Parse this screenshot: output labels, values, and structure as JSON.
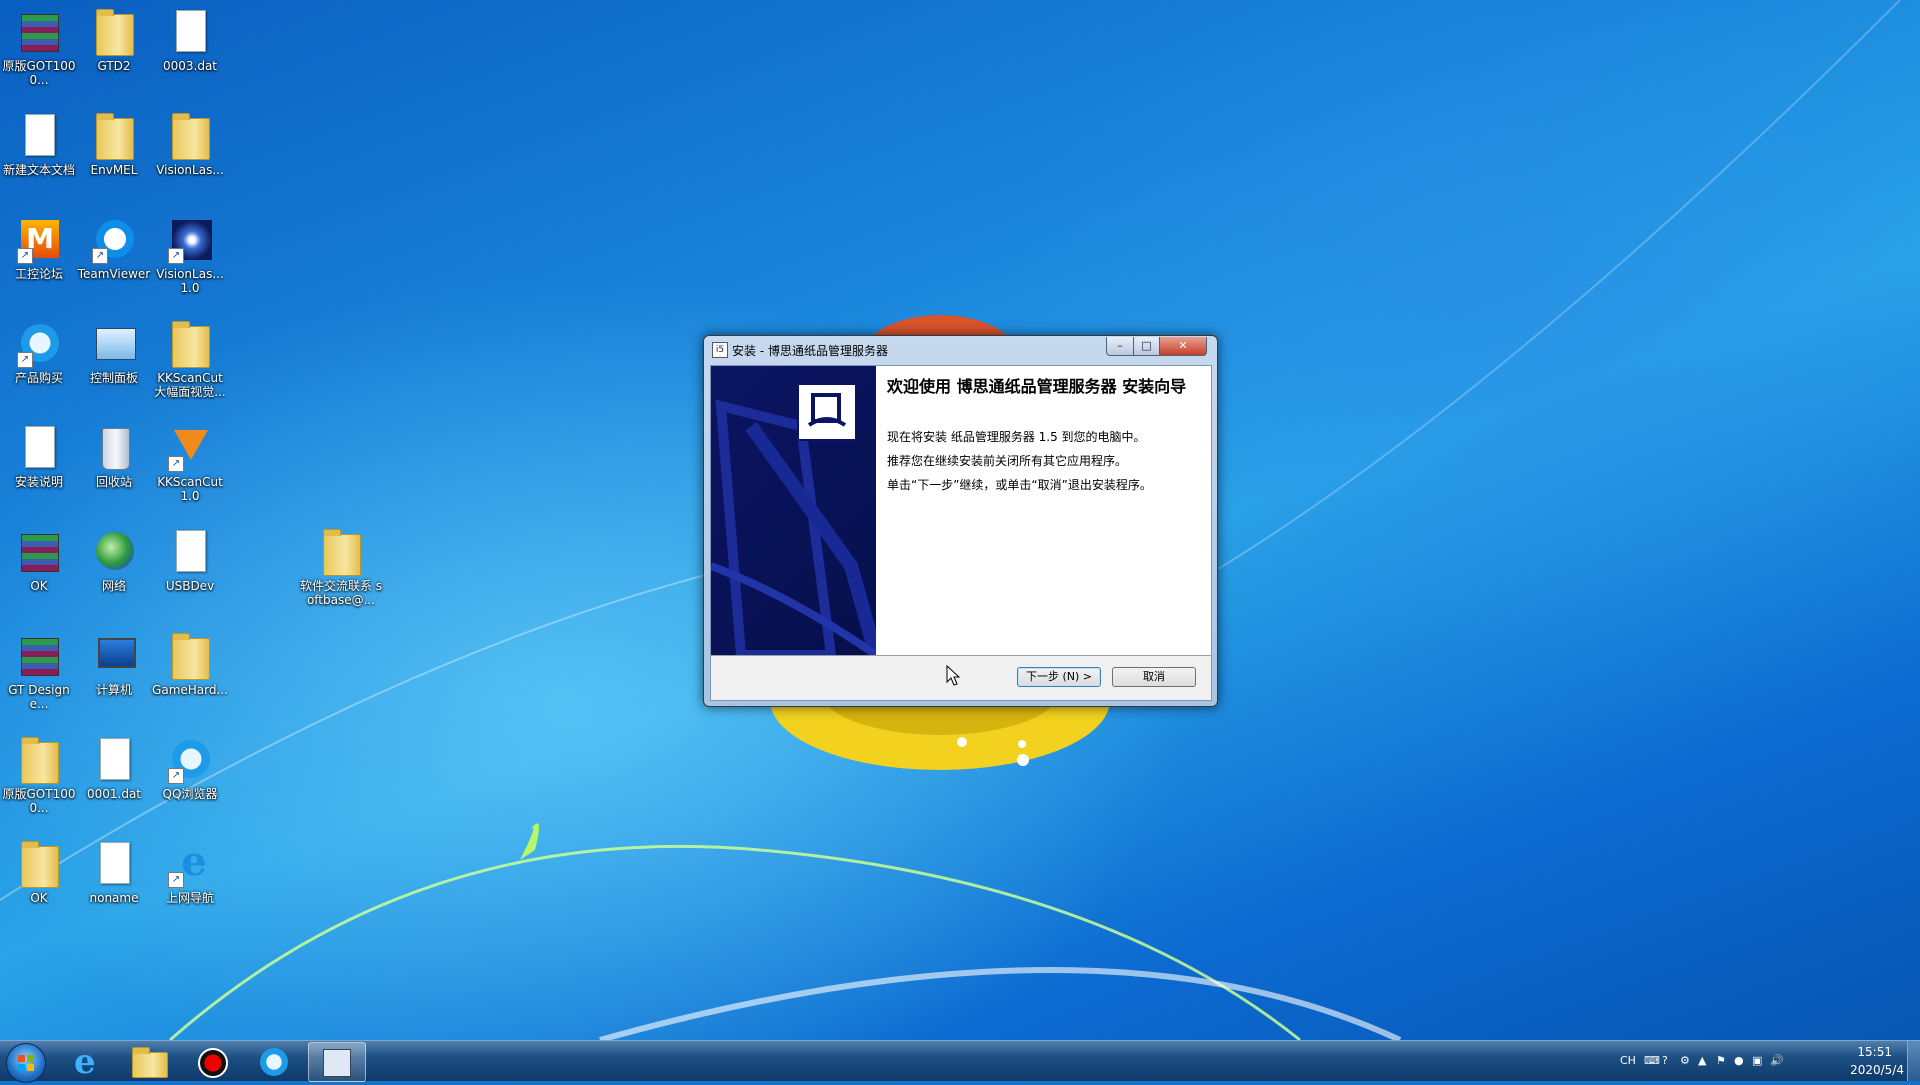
{
  "desktop": {
    "icons": [
      {
        "label": "原版GOT1000...",
        "icon": "winrar-archive-icon"
      },
      {
        "label": "GTD2",
        "icon": "folder-icon"
      },
      {
        "label": "0003.dat",
        "icon": "file-icon"
      },
      {
        "label": "新建文本文档",
        "icon": "text-file-icon"
      },
      {
        "label": "EnvMEL",
        "icon": "folder-icon"
      },
      {
        "label": "VisionLas...",
        "icon": "folder-icon"
      },
      {
        "label": "工控论坛",
        "icon": "forum-shortcut-icon"
      },
      {
        "label": "TeamViewer",
        "icon": "teamviewer-icon"
      },
      {
        "label": "VisionLas... 1.0",
        "icon": "visionlaser-app-icon"
      },
      {
        "label": "产品购买",
        "icon": "purchase-shortcut-icon"
      },
      {
        "label": "控制面板",
        "icon": "control-panel-icon"
      },
      {
        "label": "KKScanCut 大幅面视觉...",
        "icon": "folder-icon"
      },
      {
        "label": "安装说明",
        "icon": "text-file-icon"
      },
      {
        "label": "回收站",
        "icon": "recycle-bin-icon"
      },
      {
        "label": "KKScanCut 1.0",
        "icon": "kkscancut-app-icon"
      },
      {
        "label": "OK",
        "icon": "winrar-archive-icon"
      },
      {
        "label": "网络",
        "icon": "network-icon"
      },
      {
        "label": "USBDev",
        "icon": "file-icon"
      },
      {
        "label": "软件交流联系 softbase@...",
        "icon": "folder-icon"
      },
      {
        "label": "GT Designe...",
        "icon": "winrar-archive-icon"
      },
      {
        "label": "计算机",
        "icon": "computer-icon"
      },
      {
        "label": "GameHard...",
        "icon": "folder-icon"
      },
      {
        "label": "原版GOT1000...",
        "icon": "folder-icon"
      },
      {
        "label": "0001.dat",
        "icon": "file-icon"
      },
      {
        "label": "QQ浏览器",
        "icon": "qq-browser-icon"
      },
      {
        "label": "OK",
        "icon": "folder-icon"
      },
      {
        "label": "noname",
        "icon": "file-icon"
      },
      {
        "label": "上网导航",
        "icon": "ie-shortcut-icon"
      }
    ]
  },
  "dialog": {
    "title": "安装 - 博思通纸品管理服务器",
    "title_icon_text": "i5",
    "welcome_title": "欢迎使用 博思通纸品管理服务器 安装向导",
    "line1": "现在将安装 纸品管理服务器  1.5 到您的电脑中。",
    "line2": "推荐您在继续安装前关闭所有其它应用程序。",
    "line3": "单击“下一步”继续，或单击“取消”退出安装程序。",
    "next_label": "下一步 (N) >",
    "cancel_label": "取消",
    "minimize_glyph": "–",
    "maximize_glyph": "□",
    "close_glyph": "✕"
  },
  "taskbar": {
    "items": [
      {
        "name": "internet-explorer",
        "icon": "ie-icon"
      },
      {
        "name": "windows-explorer",
        "icon": "folder-icon"
      },
      {
        "name": "screen-recorder",
        "icon": "record-icon"
      },
      {
        "name": "qq-browser",
        "icon": "qq-browser-icon"
      },
      {
        "name": "setup-wizard",
        "icon": "installer-icon",
        "active": true
      }
    ],
    "tray": {
      "language": "CH",
      "time": "15:51",
      "date": "2020/5/4"
    }
  },
  "colors": {
    "banner": "#0b1462",
    "taskbar": "#1d4f84",
    "close_button": "#c7402a"
  }
}
